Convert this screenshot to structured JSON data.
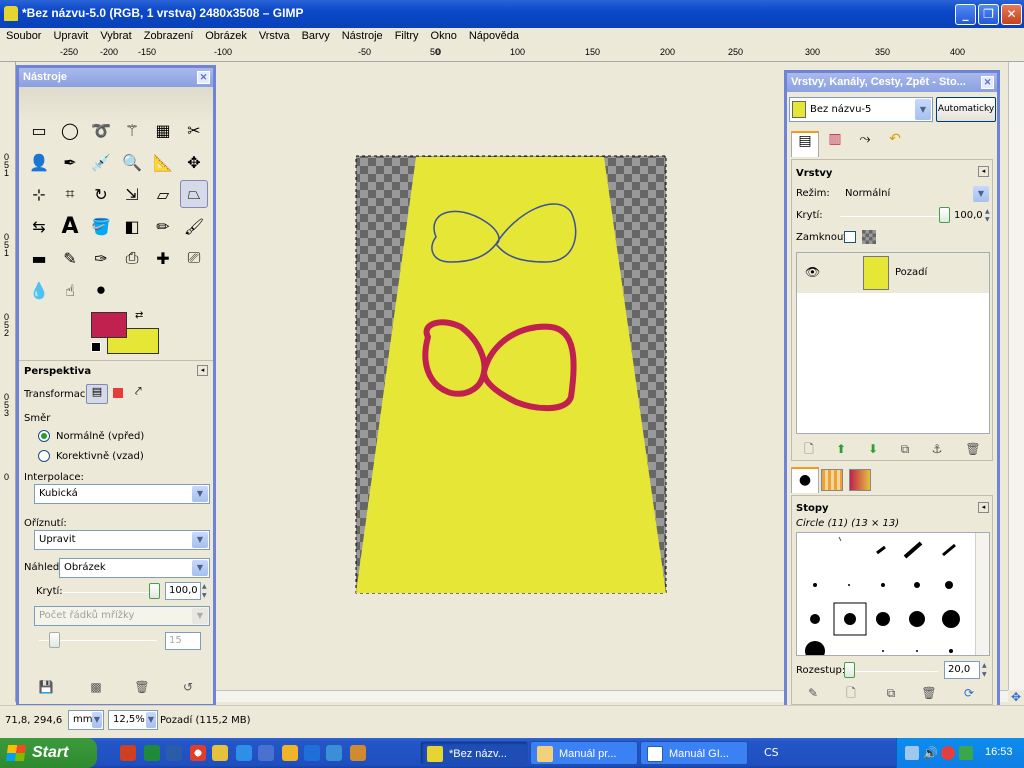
{
  "window": {
    "title": "*Bez názvu-5.0 (RGB, 1 vrstva) 2480x3508 – GIMP"
  },
  "menu": [
    "Soubor",
    "Upravit",
    "Vybrat",
    "Zobrazení",
    "Obrázek",
    "Vrstva",
    "Barvy",
    "Nástroje",
    "Filtry",
    "Okno",
    "Nápověda"
  ],
  "ruler_top_labels": [
    "-250",
    "-200",
    "-150",
    "-100",
    "-50",
    "0",
    "50",
    "100",
    "150",
    "200",
    "250",
    "300",
    "350",
    "400"
  ],
  "ruler_left_labels": [
    "0",
    "5",
    "1",
    "0",
    "5",
    "1",
    "0",
    "5",
    "2",
    "0",
    "5",
    "3",
    "0"
  ],
  "toolbox": {
    "title": "Nástroje",
    "tools": [
      "rect-select",
      "ellipse-select",
      "free-select",
      "fuzzy-select",
      "select-by-color",
      "scissors",
      "foreground-select",
      "paths",
      "color-picker",
      "zoom",
      "measure",
      "move",
      "align",
      "crop",
      "rotate",
      "scale",
      "shear",
      "perspective",
      "flip",
      "text",
      "bucket-fill",
      "blend",
      "pencil",
      "paintbrush",
      "eraser",
      "airbrush",
      "ink",
      "clone",
      "heal",
      "perspective-clone",
      "blur",
      "smudge",
      "dodge-burn"
    ],
    "fg_color": "#c0214e",
    "bg_color": "#e6e636"
  },
  "tool_options": {
    "title": "Perspektiva",
    "transform_label": "Transformace:",
    "direction_label": "Směr",
    "dir_normal": "Normálně (vpřed)",
    "dir_corrective": "Korektivně (vzad)",
    "interp_label": "Interpolace:",
    "interp_value": "Kubická",
    "clip_label": "Oříznutí:",
    "clip_value": "Upravit",
    "preview_label": "Náhled:",
    "preview_value": "Obrázek",
    "opacity_label": "Krytí:",
    "opacity_value": "100,0",
    "grid_combo": "Počet řádků mřížky",
    "grid_value": "15"
  },
  "layers_panel": {
    "title": "Vrstvy, Kanály, Cesty, Zpět - Sto...",
    "image_combo": "Bez názvu-5",
    "auto_button": "Automaticky",
    "section": "Vrstvy",
    "mode_label": "Režim:",
    "mode_value": "Normální",
    "opacity_label": "Krytí:",
    "opacity_value": "100,0",
    "lock_label": "Zamknout:",
    "layer_name": "Pozadí",
    "brushes_section": "Stopy",
    "brush_name": "Circle (11) (13 × 13)",
    "spacing_label": "Rozestup:",
    "spacing_value": "20,0"
  },
  "status": {
    "coords": "71,8, 294,6",
    "unit": "mm",
    "zoom": "12,5%",
    "info": "Pozadí (115,2 MB)"
  },
  "taskbar": {
    "start": "Start",
    "items": [
      "*Bez názv...",
      "Manuál pr...",
      "Manuál GI..."
    ],
    "lang": "CS",
    "clock": "16:53"
  },
  "colors": {
    "yellow": "#e6e636",
    "crimson": "#c0214e",
    "blue_line": "#3a4fa0",
    "titlebar": "#0a48c8"
  }
}
